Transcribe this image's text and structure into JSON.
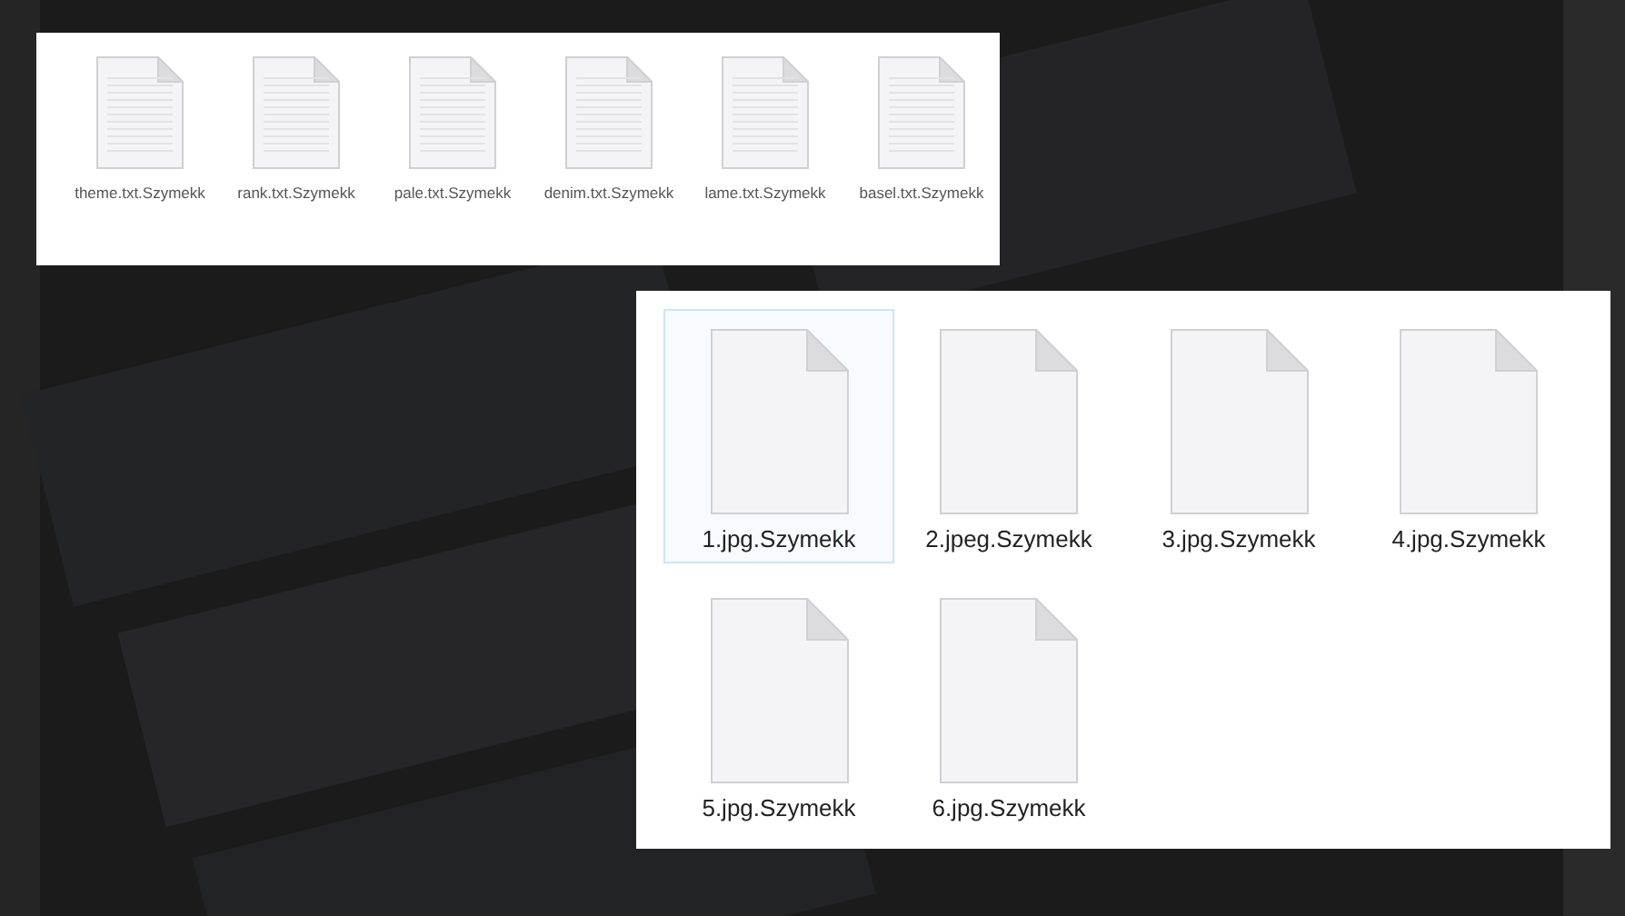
{
  "text_files_panel": {
    "files": [
      {
        "name": "theme.txt.Szymekk",
        "selected": false
      },
      {
        "name": "rank.txt.Szymekk",
        "selected": false
      },
      {
        "name": "pale.txt.Szymekk",
        "selected": false
      },
      {
        "name": "denim.txt.Szymekk",
        "selected": false
      },
      {
        "name": "lame.txt.Szymekk",
        "selected": false
      },
      {
        "name": "basel.txt.Szymekk",
        "selected": false
      }
    ]
  },
  "image_files_panel": {
    "files": [
      {
        "name": "1.jpg.Szymekk",
        "selected": true
      },
      {
        "name": "2.jpeg.Szymekk",
        "selected": false
      },
      {
        "name": "3.jpg.Szymekk",
        "selected": false
      },
      {
        "name": "4.jpg.Szymekk",
        "selected": false
      },
      {
        "name": "5.jpg.Szymekk",
        "selected": false
      },
      {
        "name": "6.jpg.Szymekk",
        "selected": false
      }
    ]
  }
}
